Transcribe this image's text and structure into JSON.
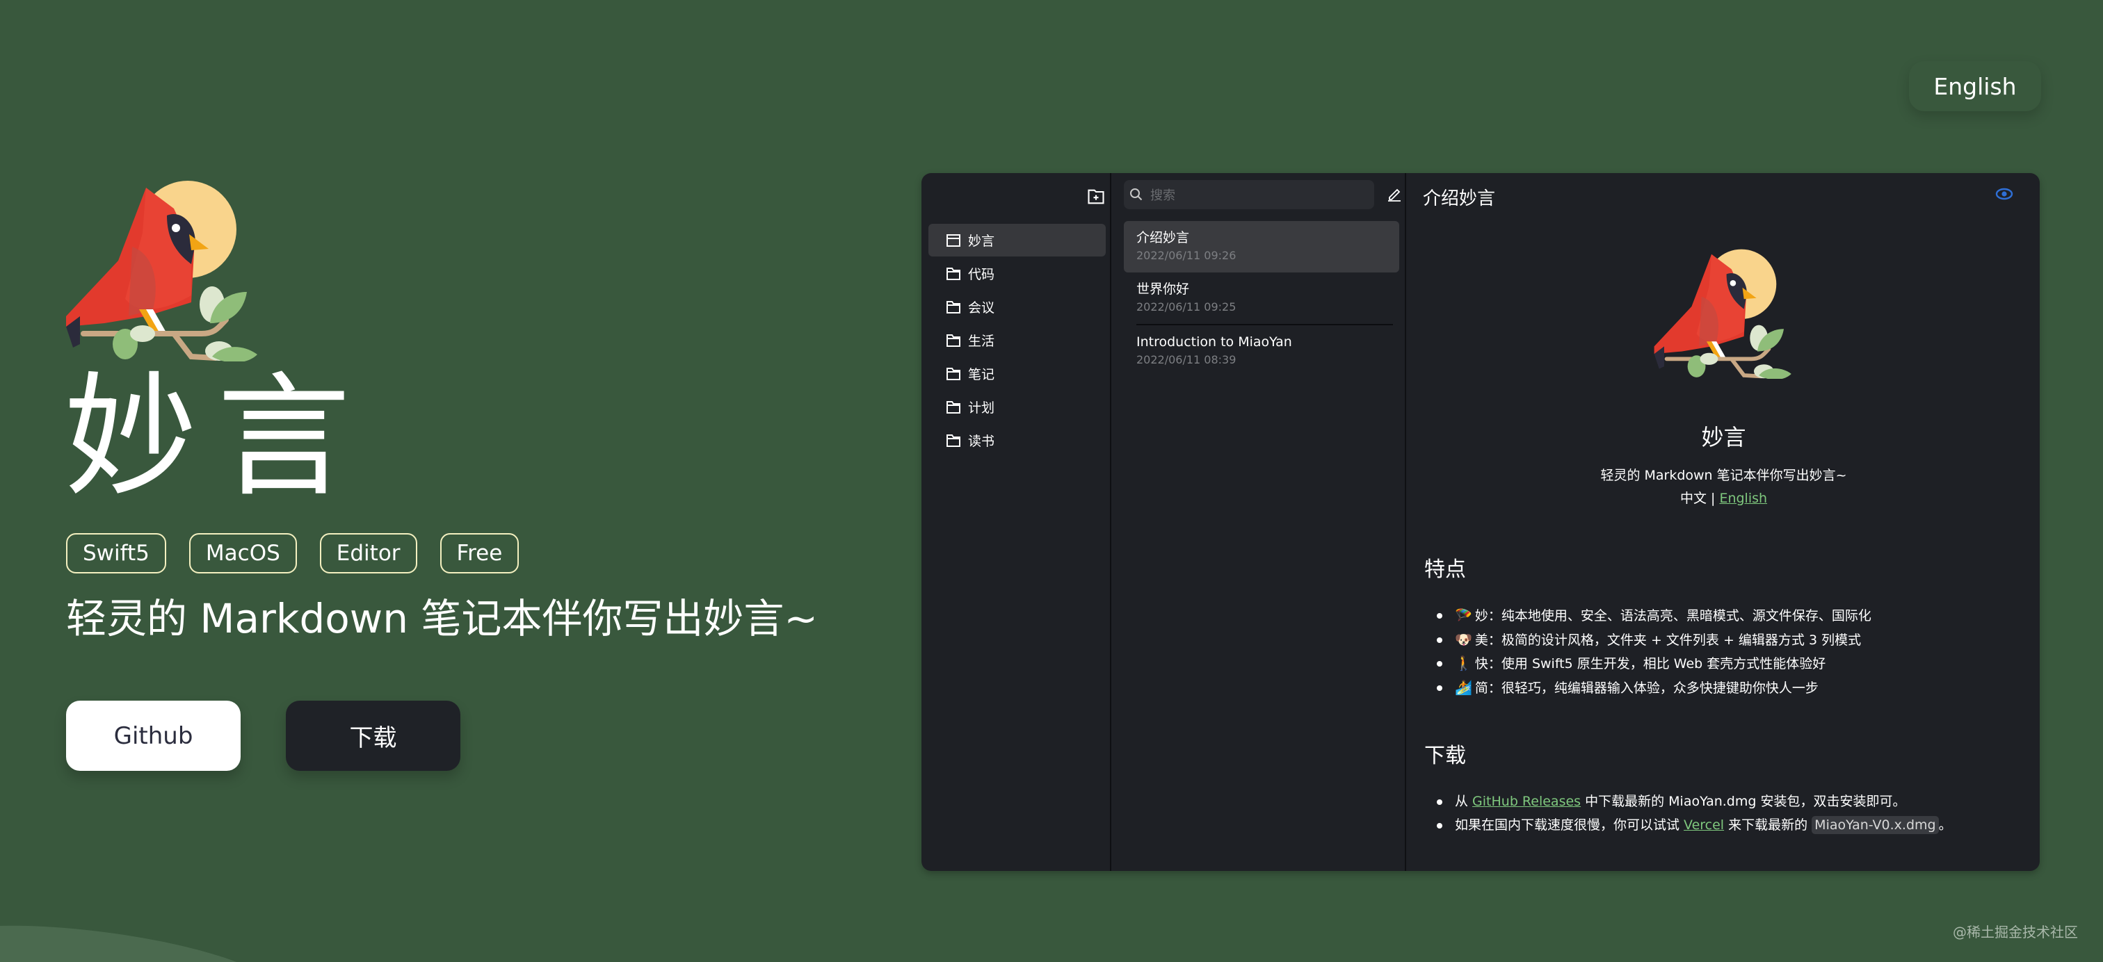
{
  "header": {
    "language_button": "English"
  },
  "hero": {
    "title": "妙言",
    "tags": [
      "Swift5",
      "MacOS",
      "Editor",
      "Free"
    ],
    "tagline": "轻灵的 Markdown 笔记本伴你写出妙言~",
    "buttons": {
      "github": "Github",
      "download": "下载"
    }
  },
  "app": {
    "sidebar": {
      "new_folder_icon": "folder-plus-icon",
      "folders": [
        {
          "label": "妙言",
          "active": true
        },
        {
          "label": "代码"
        },
        {
          "label": "会议"
        },
        {
          "label": "生活"
        },
        {
          "label": "笔记"
        },
        {
          "label": "计划"
        },
        {
          "label": "读书"
        }
      ]
    },
    "notelist": {
      "search_placeholder": "搜索",
      "notes": [
        {
          "title": "介绍妙言",
          "date": "2022/06/11 09:26",
          "active": true
        },
        {
          "title": "世界你好",
          "date": "2022/06/11 09:25"
        },
        {
          "title": "Introduction to MiaoYan",
          "date": "2022/06/11 08:39"
        }
      ]
    },
    "editor": {
      "title": "介绍妙言",
      "preview_icon": "eye-icon",
      "doc": {
        "h1": "妙言",
        "subtitle": "轻灵的 Markdown 笔记本伴你写出妙言~",
        "lang_prefix": "中文 | ",
        "lang_link": "English",
        "features_heading": "特点",
        "features": [
          {
            "emoji": "🪂",
            "text": "妙：纯本地使用、安全、语法高亮、黑暗模式、源文件保存、国际化"
          },
          {
            "emoji": "🐶",
            "text": "美：极简的设计风格，文件夹 + 文件列表 + 编辑器方式 3 列模式"
          },
          {
            "emoji": "🚶",
            "text": "快：使用 Swift5 原生开发，相比 Web 套壳方式性能体验好"
          },
          {
            "emoji": "🏄",
            "text": "简：很轻巧，纯编辑器输入体验，众多快捷键助你快人一步"
          }
        ],
        "download_heading": "下载",
        "download_items": [
          {
            "pre": "从 ",
            "link": "GitHub Releases",
            "post": " 中下载最新的 MiaoYan.dmg 安装包，双击安装即可。"
          },
          {
            "pre": "如果在国内下载速度很慢，你可以试试 ",
            "link": "Vercel",
            "mid": " 来下载最新的 ",
            "code": "MiaoYan-V0.x.dmg",
            "post": "。"
          }
        ]
      }
    }
  },
  "watermark": "@稀土掘金技术社区",
  "colors": {
    "background": "#39583d",
    "window": "#1e2025",
    "link": "#7fc87e",
    "tag_border": "#f4f0c0",
    "eye": "#2f6fd6"
  }
}
